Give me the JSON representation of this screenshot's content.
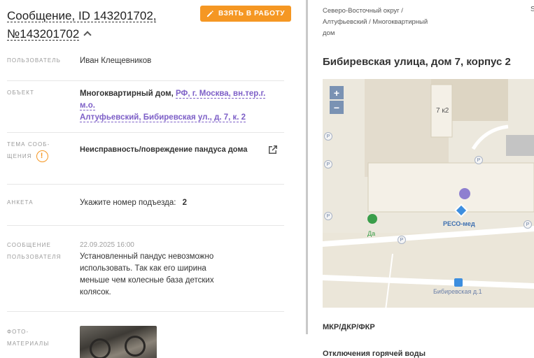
{
  "header": {
    "title_line1": "Сообщение, ID 143201702,",
    "title_line2": "№143201702",
    "take_button": "ВЗЯТЬ В РАБОТУ"
  },
  "fields": {
    "user": {
      "label": "ПОЛЬЗОВАТЕЛЬ",
      "value": "Иван Клещевников"
    },
    "object": {
      "label": "ОБЪЕКТ",
      "type": "Многоквартирный дом,",
      "address_link_part1": "РФ, г. Москва, вн.тер.г. м.о.",
      "address_link_part2": "Алтуфьевский, Бибиревская ул., д. 7, к. 2"
    },
    "topic": {
      "label_line1": "ТЕМА СООБ-",
      "label_line2": "ЩЕНИЯ",
      "warning_glyph": "!",
      "value": "Неисправность/повреждение пандуса дома"
    },
    "form": {
      "label": "АНКЕТА",
      "question": "Укажите номер подъезда:",
      "answer": "2"
    },
    "message": {
      "label_line1": "СООБЩЕНИЕ",
      "label_line2": "ПОЛЬЗОВАТЕЛЯ",
      "date": "22.09.2025 16:00",
      "text_line1": "Установленный пандус невозможно",
      "text_line2": "использовать. Так как его ширина",
      "text_line3": "меньше чем колесные база детских",
      "text_line4": "колясок."
    },
    "photos": {
      "label_line1": "ФОТО-",
      "label_line2": "МАТЕРИАЛЫ"
    }
  },
  "right": {
    "district_line1": "Северо-Восточный округ /",
    "district_line2": "Алтуфьевский / Многоквартирный",
    "district_line3": "дом",
    "corner_letter": "S",
    "address": "Бибиревская улица, дом 7, корпус 2",
    "map": {
      "zoom_in": "+",
      "zoom_out": "−",
      "building_label": "7 к2",
      "pharmacy_label": "РЕСО-мед",
      "bus_stop_label": "Бибиревская д.1",
      "shop_label": "Да",
      "parking": "P"
    },
    "section_mkr": "МКР/ДКР/ФКР",
    "section_hot_water": "Отключения горячей воды"
  },
  "colors": {
    "accent_orange": "#f59723",
    "link_purple": "#7d5fc7",
    "map_marker": "#8e7fd0"
  }
}
